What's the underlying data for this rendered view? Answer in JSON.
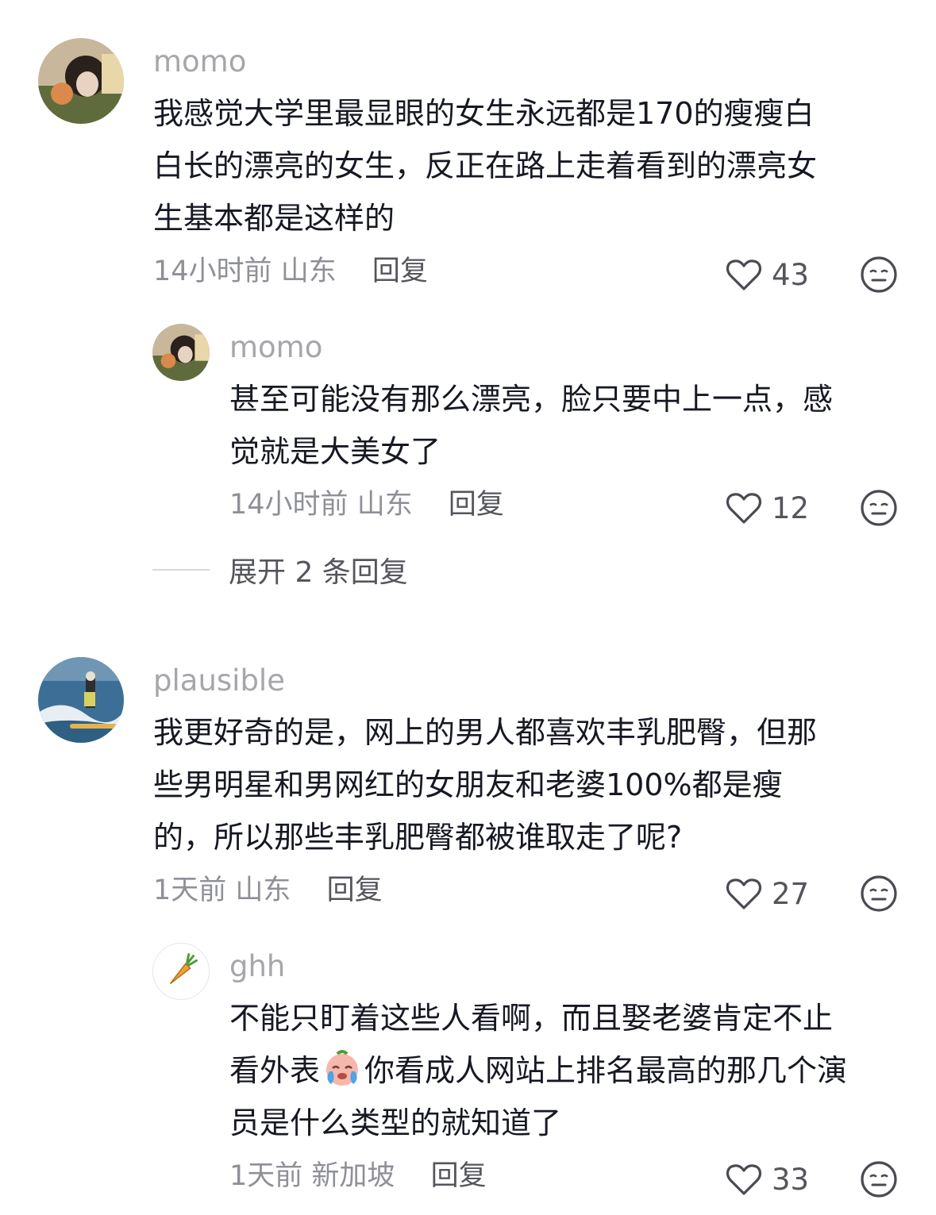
{
  "comments": [
    {
      "username": "momo",
      "text_lines": [
        "我感觉大学里最显眼的女生永远都是170的瘦瘦白",
        "白长的漂亮的女生，反正在路上走着看到的漂亮女",
        "生基本都是这样的"
      ],
      "time": "14小时前",
      "location": "山东",
      "reply_label": "回复",
      "likes": "43"
    },
    {
      "username": "momo",
      "text_lines": [
        "甚至可能没有那么漂亮，脸只要中上一点，感",
        "觉就是大美女了"
      ],
      "time": "14小时前",
      "location": "山东",
      "reply_label": "回复",
      "likes": "12"
    },
    {
      "username": "plausible",
      "text_lines": [
        "我更好奇的是，网上的男人都喜欢丰乳肥臀，但那",
        "些男明星和男网红的女朋友和老婆100%都是瘦",
        "的，所以那些丰乳肥臀都被谁取走了呢?"
      ],
      "time": "1天前",
      "location": "山东",
      "reply_label": "回复",
      "likes": "27"
    },
    {
      "username": "ghh",
      "text_lines": [
        "不能只盯着这些人看啊，而且娶老婆肯定不止",
        "看外表",
        "你看成人网站上排名最高的那几个演",
        "员是什么类型的就知道了"
      ],
      "time": "1天前",
      "location": "新加坡",
      "reply_label": "回复",
      "likes": "33"
    }
  ],
  "expand_replies": "展开 2 条回复",
  "icons": {
    "like": "heart-outline-icon",
    "dislike": "meh-face-icon",
    "emoji": "crying-face-emoji",
    "avatar_ghh": "carrot-icon"
  }
}
